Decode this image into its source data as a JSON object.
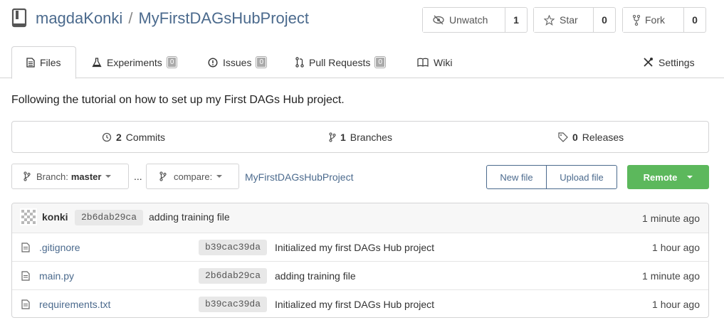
{
  "repo": {
    "owner": "magdaKonki",
    "separator": "/",
    "name": "MyFirstDAGsHubProject"
  },
  "actions": {
    "watch": {
      "label": "Unwatch",
      "count": "1"
    },
    "star": {
      "label": "Star",
      "count": "0"
    },
    "fork": {
      "label": "Fork",
      "count": "0"
    }
  },
  "tabs": {
    "files": {
      "label": "Files"
    },
    "experiments": {
      "label": "Experiments",
      "count": "0"
    },
    "issues": {
      "label": "Issues",
      "count": "0"
    },
    "pulls": {
      "label": "Pull Requests",
      "count": "0"
    },
    "wiki": {
      "label": "Wiki"
    },
    "settings": {
      "label": "Settings"
    }
  },
  "description": "Following the tutorial on how to set up my First DAGs Hub project.",
  "stats": {
    "commits": {
      "count": "2",
      "label": "Commits"
    },
    "branches": {
      "count": "1",
      "label": "Branches"
    },
    "releases": {
      "count": "0",
      "label": "Releases"
    }
  },
  "branch": {
    "prefix": "Branch:",
    "name": "master"
  },
  "compare_label": "compare:",
  "ellipsis": "...",
  "path": "MyFirstDAGsHubProject",
  "buttons": {
    "new_file": "New file",
    "upload_file": "Upload file",
    "remote": "Remote"
  },
  "latest_commit": {
    "author": "konki",
    "sha": "2b6dab29ca",
    "message": "adding training file",
    "time": "1 minute ago"
  },
  "files": [
    {
      "name": ".gitignore",
      "sha": "b39cac39da",
      "message": "Initialized my first DAGs Hub project",
      "time": "1 hour ago"
    },
    {
      "name": "main.py",
      "sha": "2b6dab29ca",
      "message": "adding training file",
      "time": "1 minute ago"
    },
    {
      "name": "requirements.txt",
      "sha": "b39cac39da",
      "message": "Initialized my first DAGs Hub project",
      "time": "1 hour ago"
    }
  ],
  "colors": {
    "link": "#4b6a8d",
    "remote_button": "#5cb85c",
    "border": "#d4d4d5"
  },
  "icons": [
    "repo-icon",
    "eye-slash-icon",
    "star-icon",
    "fork-icon",
    "file-text-icon",
    "flask-icon",
    "info-circle-icon",
    "pull-request-icon",
    "book-icon",
    "wrench-icon",
    "history-icon",
    "branch-icon",
    "tag-icon",
    "avatar-identicon",
    "file-icon"
  ]
}
